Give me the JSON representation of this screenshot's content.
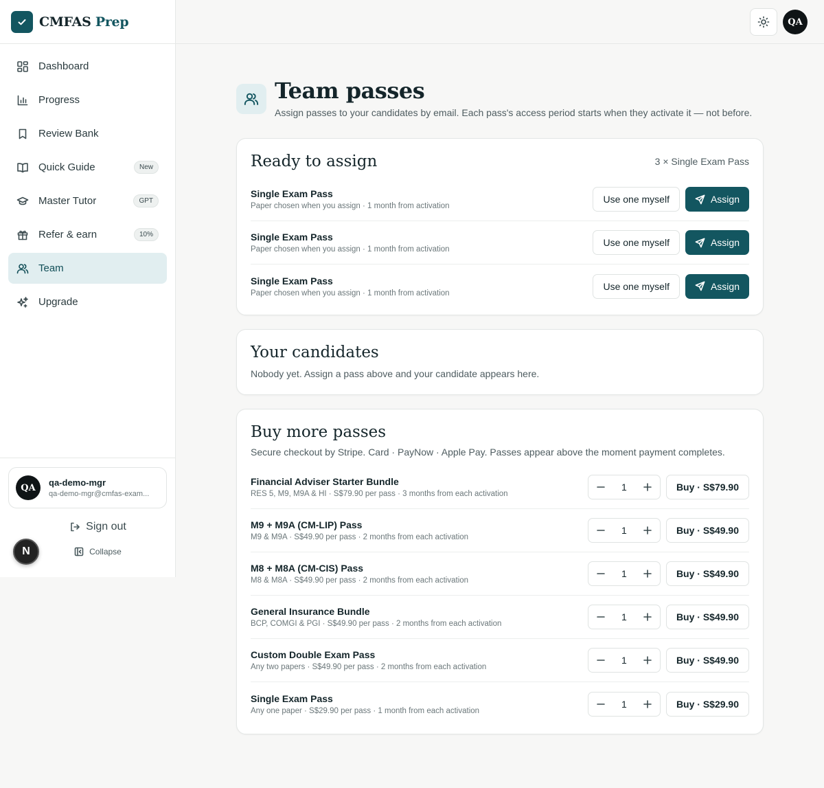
{
  "brand": {
    "name_part1": "CMFAS",
    "name_part2": "Prep"
  },
  "sidebar": {
    "items": [
      {
        "label": "Dashboard",
        "icon": "dashboard-icon",
        "badge": ""
      },
      {
        "label": "Progress",
        "icon": "chart-icon",
        "badge": ""
      },
      {
        "label": "Review Bank",
        "icon": "bookmark-icon",
        "badge": ""
      },
      {
        "label": "Quick Guide",
        "icon": "book-icon",
        "badge": "New"
      },
      {
        "label": "Master Tutor",
        "icon": "graduation-cap-icon",
        "badge": "GPT"
      },
      {
        "label": "Refer & earn",
        "icon": "gift-icon",
        "badge": "10%"
      },
      {
        "label": "Team",
        "icon": "users-icon",
        "badge": ""
      },
      {
        "label": "Upgrade",
        "icon": "sparkles-icon",
        "badge": ""
      }
    ],
    "active": "Team"
  },
  "user": {
    "initials": "QA",
    "name": "qa-demo-mgr",
    "email": "qa-demo-mgr@cmfas-exam..."
  },
  "sidebar_footer": {
    "sign_out": "Sign out",
    "collapse": "Collapse",
    "dev_badge": "N"
  },
  "topbar": {
    "avatar_initials": "QA"
  },
  "page": {
    "title": "Team passes",
    "subtitle": "Assign passes to your candidates by email. Each pass's access period starts when they activate it — not before."
  },
  "ready": {
    "title": "Ready to assign",
    "count": "3 × Single Exam Pass",
    "use_label": "Use one myself",
    "assign_label": "Assign",
    "passes": [
      {
        "name": "Single Exam Pass",
        "desc": "Paper chosen when you assign · 1 month from activation"
      },
      {
        "name": "Single Exam Pass",
        "desc": "Paper chosen when you assign · 1 month from activation"
      },
      {
        "name": "Single Exam Pass",
        "desc": "Paper chosen when you assign · 1 month from activation"
      }
    ]
  },
  "candidates": {
    "title": "Your candidates",
    "empty": "Nobody yet. Assign a pass above and your candidate appears here."
  },
  "buy": {
    "title": "Buy more passes",
    "desc": "Secure checkout by Stripe. Card · PayNow · Apple Pay. Passes appear above the moment payment completes.",
    "products": [
      {
        "name": "Financial Adviser Starter Bundle",
        "desc": "RES 5, M9, M9A & HI · S$79.90 per pass · 3 months from each activation",
        "qty": "1",
        "buy": "Buy · S$79.90"
      },
      {
        "name": "M9 + M9A (CM-LIP) Pass",
        "desc": "M9 & M9A · S$49.90 per pass · 2 months from each activation",
        "qty": "1",
        "buy": "Buy · S$49.90"
      },
      {
        "name": "M8 + M8A (CM-CIS) Pass",
        "desc": "M8 & M8A · S$49.90 per pass · 2 months from each activation",
        "qty": "1",
        "buy": "Buy · S$49.90"
      },
      {
        "name": "General Insurance Bundle",
        "desc": "BCP, COMGI & PGI · S$49.90 per pass · 2 months from each activation",
        "qty": "1",
        "buy": "Buy · S$49.90"
      },
      {
        "name": "Custom Double Exam Pass",
        "desc": "Any two papers · S$49.90 per pass · 2 months from each activation",
        "qty": "1",
        "buy": "Buy · S$49.90"
      },
      {
        "name": "Single Exam Pass",
        "desc": "Any one paper · S$29.90 per pass · 1 month from each activation",
        "qty": "1",
        "buy": "Buy · S$29.90"
      }
    ]
  },
  "colors": {
    "accent": "#135660",
    "active_bg": "#e1eef0"
  }
}
